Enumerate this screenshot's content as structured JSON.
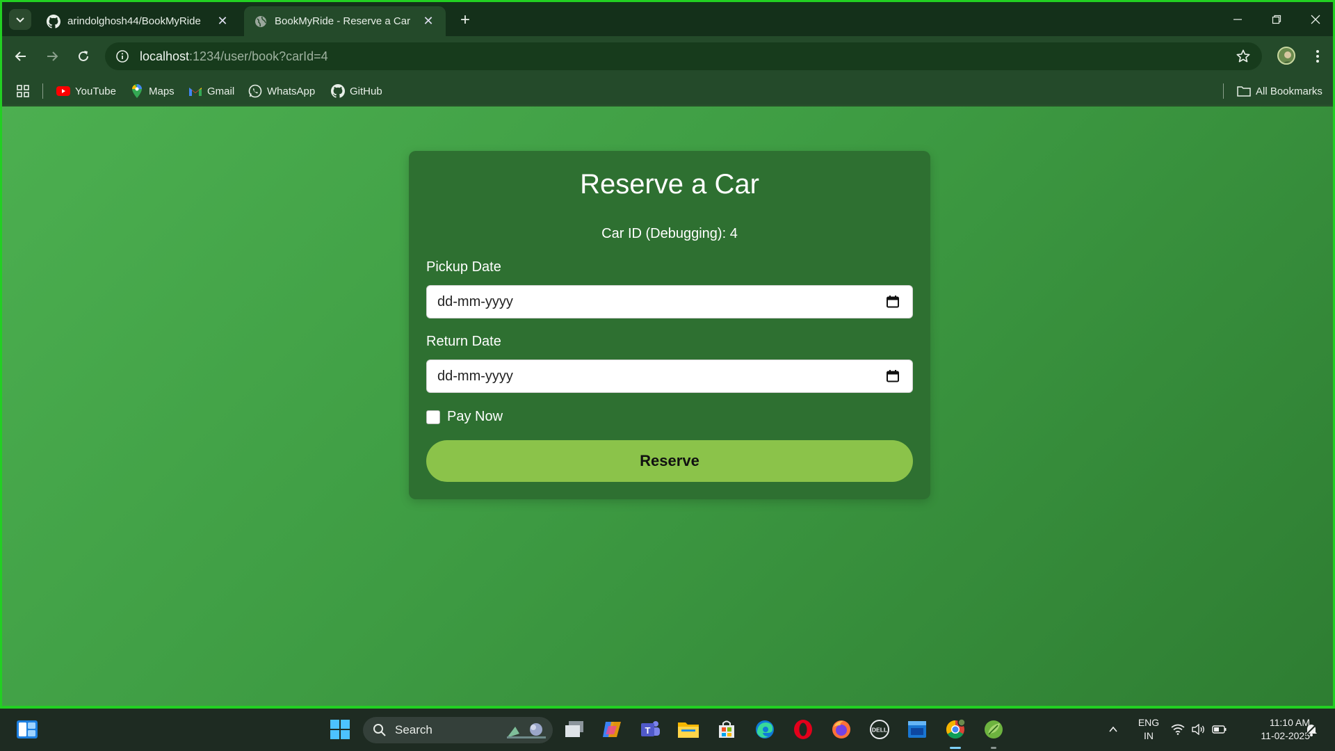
{
  "browser": {
    "tabs": [
      {
        "title": "arindolghosh44/BookMyRide",
        "icon": "github-icon"
      },
      {
        "title": "BookMyRide - Reserve a Car",
        "icon": "globe-icon",
        "active": true
      }
    ],
    "new_tab_label": "+",
    "url_host": "localhost",
    "url_path": ":1234/user/book?carId=4",
    "bookmarks": [
      {
        "label": "YouTube",
        "icon": "youtube-icon"
      },
      {
        "label": "Maps",
        "icon": "maps-icon"
      },
      {
        "label": "Gmail",
        "icon": "gmail-icon"
      },
      {
        "label": "WhatsApp",
        "icon": "whatsapp-icon"
      },
      {
        "label": "GitHub",
        "icon": "github-icon"
      }
    ],
    "all_bookmarks_label": "All Bookmarks"
  },
  "page": {
    "title": "Reserve a Car",
    "car_id_text": "Car ID (Debugging): 4",
    "pickup_label": "Pickup Date",
    "pickup_placeholder": "dd-mm-yyyy",
    "return_label": "Return Date",
    "return_placeholder": "dd-mm-yyyy",
    "pay_now_label": "Pay Now",
    "pay_now_checked": false,
    "reserve_button": "Reserve"
  },
  "taskbar": {
    "search_label": "Search",
    "language": "ENG",
    "region": "IN",
    "time": "11:10 AM",
    "date": "11-02-2025"
  },
  "colors": {
    "page_gradient_start": "#4caf50",
    "page_gradient_end": "#2e7d32",
    "card_bg": "#2e7031",
    "button_bg": "#8bc34a"
  }
}
